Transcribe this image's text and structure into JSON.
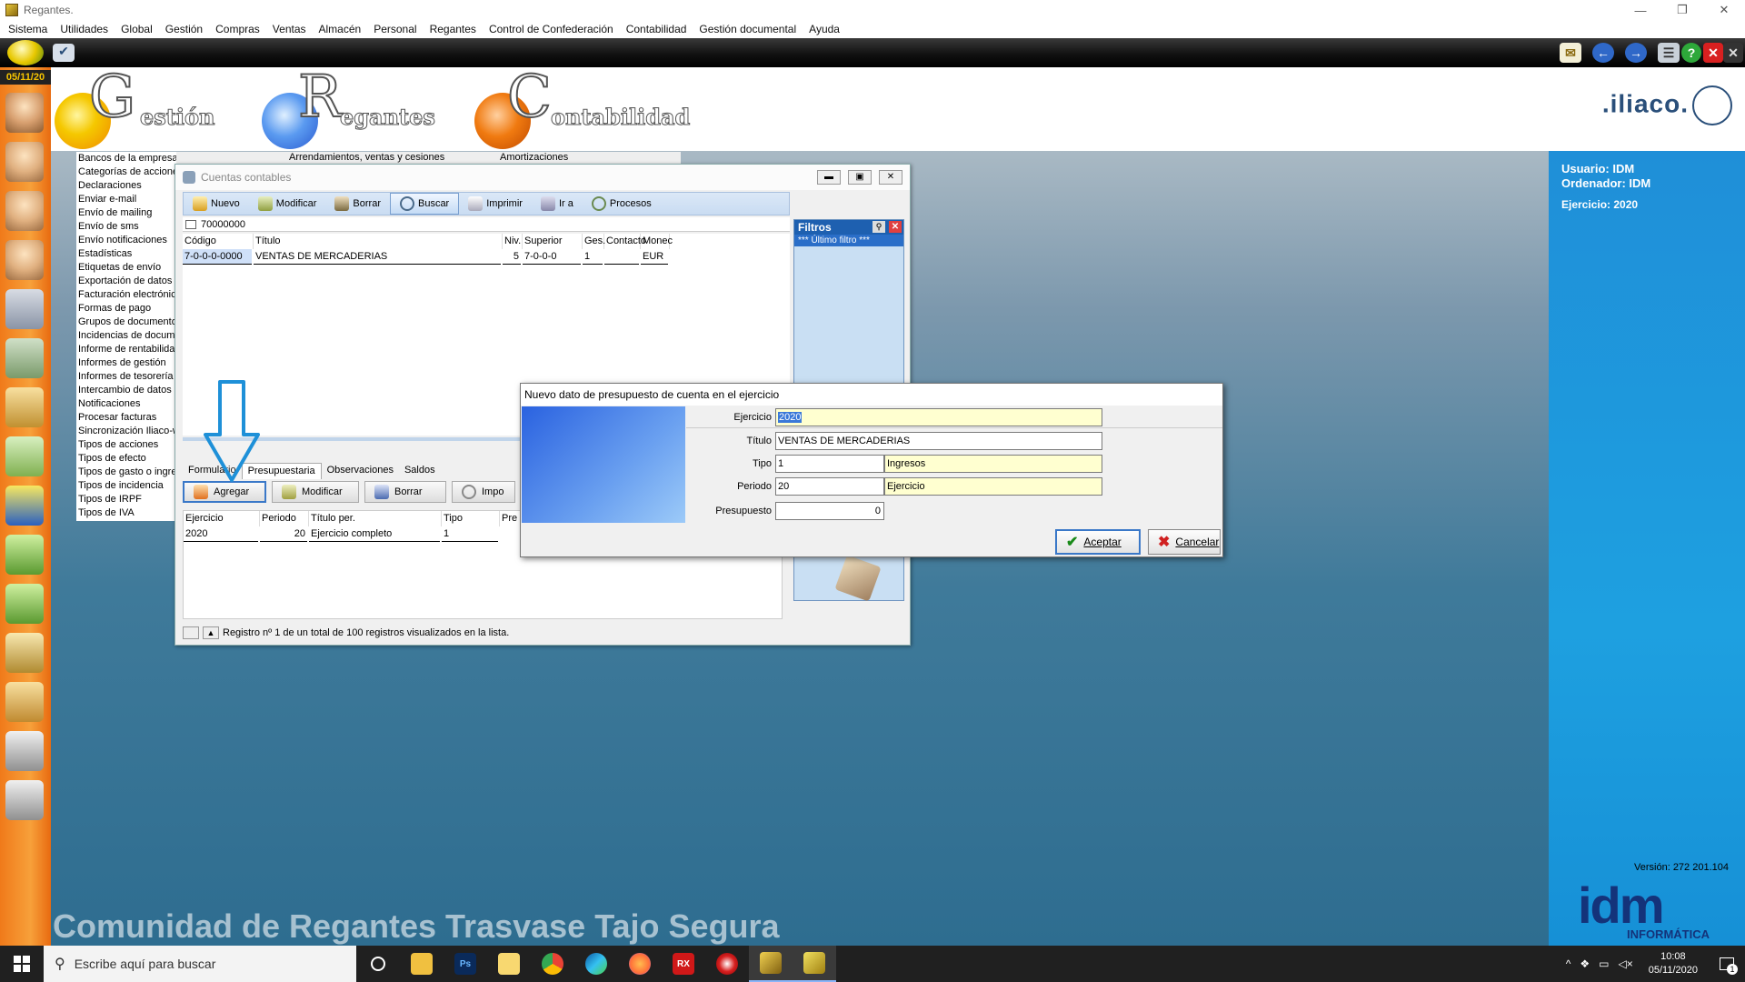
{
  "window": {
    "title": "Regantes.",
    "controls": [
      "—",
      "❐",
      "✕"
    ]
  },
  "menu": [
    "Sistema",
    "Utilidades",
    "Global",
    "Gestión",
    "Compras",
    "Ventas",
    "Almacén",
    "Personal",
    "Regantes",
    "Control de Confederación",
    "Contabilidad",
    "Gestión documental",
    "Ayuda"
  ],
  "leftbar": {
    "date": "05/11/20"
  },
  "header": {
    "logos": [
      {
        "big": "G",
        "rest": "estión"
      },
      {
        "big": "R",
        "rest": "egantes"
      },
      {
        "big": "C",
        "rest": "ontabilidad"
      }
    ],
    "brand": ".iliaco."
  },
  "sidelist": [
    "Bancos de la empresa",
    "Categorías de acciones",
    "Declaraciones",
    "Enviar e-mail",
    "Envío de mailing",
    "Envío de sms",
    "Envío notificaciones",
    "Estadísticas",
    "Etiquetas de envío",
    "Exportación de datos a",
    "Facturación electrónica",
    "Formas de pago",
    "Grupos de documentos",
    "Incidencias de documentos",
    "Informe de rentabilidad",
    "Informes de gestión",
    "Informes de tesorería",
    "Intercambio de datos",
    "Notificaciones",
    "Procesar facturas",
    "Sincronización Iliaco-w",
    "Tipos de acciones",
    "Tipos de efecto",
    "Tipos de gasto o ingreso",
    "Tipos de incidencia",
    "Tipos de IRPF",
    "Tipos de IVA"
  ],
  "toptabs": [
    "Arrendamientos, ventas y cesiones",
    "Amortizaciones"
  ],
  "info": {
    "user": "Usuario: IDM",
    "computer": "Ordenador: IDM",
    "year": "Ejercicio: 2020",
    "version": "Versión: 272 201.104",
    "logo": "idm",
    "logo_sub": "INFORMÁTICA"
  },
  "banner": "Comunidad de Regantes Trasvase Tajo Segura",
  "cuentas": {
    "title": "Cuentas contables",
    "toolbar": [
      "Nuevo",
      "Modificar",
      "Borrar",
      "Buscar",
      "Imprimir",
      "Ir a",
      "Procesos"
    ],
    "search": "70000000",
    "columns": [
      "Código",
      "Título",
      "Niv.",
      "Superior",
      "Ges.",
      "Contacto",
      "Monec"
    ],
    "rows": [
      {
        "codigo": "7-0-0-0-0000",
        "titulo": "VENTAS DE MERCADERIAS",
        "niv": "5",
        "superior": "7-0-0-0",
        "ges": "1",
        "contacto": "",
        "moneda": "EUR"
      }
    ],
    "filters": {
      "title": "Filtros",
      "selected": "*** Último filtro ***"
    },
    "subtabs": [
      "Formulario",
      "Presupuestaria",
      "Observaciones",
      "Saldos"
    ],
    "subtoolbar": [
      "Agregar",
      "Modificar",
      "Borrar",
      "Impo"
    ],
    "subcolumns": [
      "Ejercicio",
      "Periodo",
      "Título per.",
      "Tipo",
      "Pre"
    ],
    "subrows": [
      {
        "ejercicio": "2020",
        "periodo": "20",
        "titulo": "Ejercicio completo",
        "tipo": "1"
      }
    ],
    "status": "Registro nº 1 de un total de 100 registros visualizados en la lista."
  },
  "dialog": {
    "title": "Nuevo dato de presupuesto de cuenta en el ejercicio",
    "ejercicio_label": "Ejercicio",
    "ejercicio": "2020",
    "titulo_label": "Título",
    "titulo": "VENTAS DE MERCADERIAS",
    "tipo_label": "Tipo",
    "tipo": "1",
    "tipo_desc": "Ingresos",
    "periodo_label": "Periodo",
    "periodo": "20",
    "periodo_desc": "Ejercicio",
    "presupuesto_label": "Presupuesto",
    "presupuesto": "0",
    "accept": "Aceptar",
    "cancel": "Cancelar"
  },
  "taskbar": {
    "search_placeholder": "Escribe aquí para buscar",
    "time": "10:08",
    "date": "05/11/2020",
    "notif_count": "1"
  },
  "colors": {
    "leftbar": "#f39a30",
    "infopanel": "#1e98dc",
    "accent": "#3a78c8"
  }
}
